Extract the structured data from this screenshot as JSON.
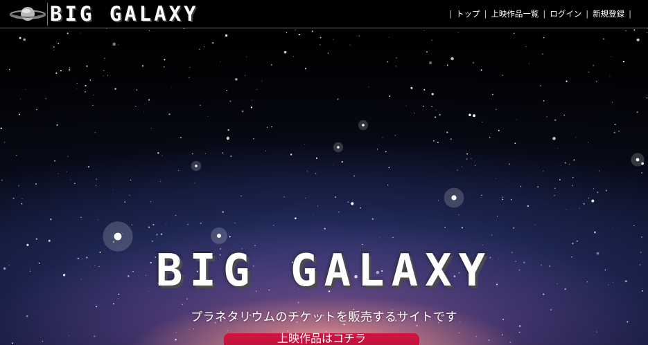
{
  "header": {
    "logo_text": "BIG GALAXY",
    "nav": [
      {
        "label": "トップ"
      },
      {
        "label": "上映作品一覧"
      },
      {
        "label": "ログイン"
      },
      {
        "label": "新規登録"
      }
    ]
  },
  "hero": {
    "title": "BIG GALAXY",
    "subtitle": "プラネタリウムのチケットを販売するサイトです",
    "cta_label": "上映作品はコチラ"
  },
  "colors": {
    "header_bg": "#000000",
    "cta": "#c8103c",
    "text": "#ffffff"
  },
  "icons": {
    "logo": "saturn-icon"
  }
}
